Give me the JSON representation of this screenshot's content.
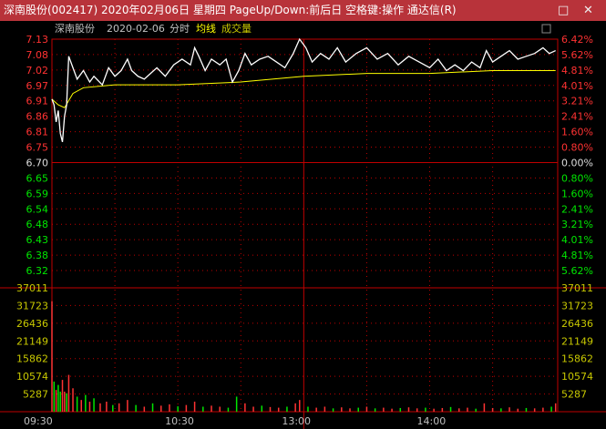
{
  "window": {
    "title": "深南股份(002417) 2020年02月06日 星期四 PageUp/Down:前后日 空格键:操作 通达信(R)",
    "restore": "□",
    "close": "✕"
  },
  "header": {
    "stock": "深南股份",
    "date": "2020-02-06",
    "mode": "分时",
    "avg_label": "均线",
    "vol_label": "成交量"
  },
  "colors": {
    "up": "#ff3232",
    "down": "#00e600",
    "price_line": "#ffffff",
    "avg_line": "#ffff00",
    "grid": "#c00000",
    "title_bg": "#b8333a"
  },
  "chart_data": {
    "type": "line",
    "prev_close": 6.7,
    "ylim": [
      6.32,
      7.13
    ],
    "price_ticks": [
      "7.13",
      "7.08",
      "7.02",
      "6.97",
      "6.91",
      "6.86",
      "6.81",
      "6.75",
      "6.70",
      "6.65",
      "6.59",
      "6.54",
      "6.48",
      "6.43",
      "6.38",
      "6.32"
    ],
    "pct_ticks": [
      "6.42%",
      "5.62%",
      "4.81%",
      "4.01%",
      "3.21%",
      "2.41%",
      "1.60%",
      "0.80%",
      "0.00%",
      "0.80%",
      "1.60%",
      "2.41%",
      "3.21%",
      "4.01%",
      "4.81%",
      "5.62%"
    ],
    "vol_ticks": [
      "37011",
      "31723",
      "26436",
      "21149",
      "15862",
      "10574",
      "5287"
    ],
    "vol_ylim": [
      0,
      37011
    ],
    "x_ticks": [
      "09:30",
      "10:30",
      "13:00",
      "14:00"
    ],
    "price": [
      [
        0,
        6.92
      ],
      [
        1,
        6.9
      ],
      [
        2,
        6.84
      ],
      [
        3,
        6.88
      ],
      [
        4,
        6.8
      ],
      [
        5,
        6.77
      ],
      [
        6,
        6.86
      ],
      [
        7,
        6.9
      ],
      [
        8,
        7.07
      ],
      [
        10,
        7.03
      ],
      [
        12,
        6.99
      ],
      [
        15,
        7.02
      ],
      [
        18,
        6.98
      ],
      [
        20,
        7.0
      ],
      [
        24,
        6.97
      ],
      [
        27,
        7.03
      ],
      [
        30,
        7.0
      ],
      [
        33,
        7.02
      ],
      [
        36,
        7.06
      ],
      [
        38,
        7.02
      ],
      [
        41,
        7.0
      ],
      [
        44,
        6.99
      ],
      [
        47,
        7.01
      ],
      [
        50,
        7.03
      ],
      [
        54,
        7.0
      ],
      [
        58,
        7.04
      ],
      [
        62,
        7.06
      ],
      [
        66,
        7.04
      ],
      [
        68,
        7.1
      ],
      [
        70,
        7.07
      ],
      [
        73,
        7.02
      ],
      [
        76,
        7.06
      ],
      [
        80,
        7.04
      ],
      [
        83,
        7.06
      ],
      [
        86,
        6.98
      ],
      [
        89,
        7.02
      ],
      [
        92,
        7.08
      ],
      [
        95,
        7.04
      ],
      [
        99,
        7.06
      ],
      [
        103,
        7.07
      ],
      [
        107,
        7.05
      ],
      [
        111,
        7.03
      ],
      [
        115,
        7.08
      ],
      [
        118,
        7.13
      ],
      [
        121,
        7.1
      ],
      [
        124,
        7.05
      ],
      [
        128,
        7.08
      ],
      [
        132,
        7.06
      ],
      [
        136,
        7.1
      ],
      [
        140,
        7.05
      ],
      [
        145,
        7.08
      ],
      [
        150,
        7.1
      ],
      [
        155,
        7.06
      ],
      [
        160,
        7.08
      ],
      [
        165,
        7.04
      ],
      [
        170,
        7.07
      ],
      [
        175,
        7.05
      ],
      [
        180,
        7.03
      ],
      [
        184,
        7.06
      ],
      [
        188,
        7.02
      ],
      [
        192,
        7.04
      ],
      [
        196,
        7.02
      ],
      [
        200,
        7.05
      ],
      [
        204,
        7.03
      ],
      [
        207,
        7.09
      ],
      [
        210,
        7.05
      ],
      [
        214,
        7.07
      ],
      [
        218,
        7.09
      ],
      [
        222,
        7.06
      ],
      [
        226,
        7.07
      ],
      [
        230,
        7.08
      ],
      [
        234,
        7.1
      ],
      [
        237,
        7.08
      ],
      [
        240,
        7.09
      ]
    ],
    "avg": [
      [
        0,
        6.92
      ],
      [
        3,
        6.9
      ],
      [
        6,
        6.89
      ],
      [
        10,
        6.94
      ],
      [
        15,
        6.96
      ],
      [
        30,
        6.97
      ],
      [
        60,
        6.97
      ],
      [
        90,
        6.98
      ],
      [
        120,
        7.0
      ],
      [
        150,
        7.01
      ],
      [
        180,
        7.01
      ],
      [
        210,
        7.02
      ],
      [
        240,
        7.02
      ]
    ],
    "volume": [
      [
        0,
        33000,
        "u"
      ],
      [
        1,
        9000,
        "d"
      ],
      [
        2,
        6500,
        "u"
      ],
      [
        3,
        8000,
        "d"
      ],
      [
        4,
        6000,
        "d"
      ],
      [
        5,
        9500,
        "u"
      ],
      [
        6,
        6000,
        "u"
      ],
      [
        7,
        5500,
        "d"
      ],
      [
        8,
        11000,
        "u"
      ],
      [
        10,
        7000,
        "u"
      ],
      [
        12,
        4500,
        "d"
      ],
      [
        14,
        3500,
        "u"
      ],
      [
        16,
        5000,
        "d"
      ],
      [
        18,
        3000,
        "u"
      ],
      [
        20,
        4000,
        "d"
      ],
      [
        23,
        2500,
        "u"
      ],
      [
        26,
        3000,
        "u"
      ],
      [
        29,
        2000,
        "d"
      ],
      [
        32,
        2500,
        "u"
      ],
      [
        36,
        3500,
        "u"
      ],
      [
        40,
        2000,
        "d"
      ],
      [
        44,
        1500,
        "u"
      ],
      [
        48,
        2500,
        "d"
      ],
      [
        52,
        1800,
        "u"
      ],
      [
        56,
        2200,
        "u"
      ],
      [
        60,
        1600,
        "d"
      ],
      [
        64,
        2000,
        "u"
      ],
      [
        68,
        3000,
        "u"
      ],
      [
        72,
        1500,
        "d"
      ],
      [
        76,
        1800,
        "u"
      ],
      [
        80,
        1500,
        "u"
      ],
      [
        84,
        1200,
        "d"
      ],
      [
        88,
        4500,
        "d"
      ],
      [
        92,
        2500,
        "u"
      ],
      [
        96,
        1500,
        "u"
      ],
      [
        100,
        1800,
        "d"
      ],
      [
        104,
        1400,
        "u"
      ],
      [
        108,
        1200,
        "u"
      ],
      [
        112,
        1500,
        "d"
      ],
      [
        116,
        2500,
        "u"
      ],
      [
        118,
        3500,
        "u"
      ],
      [
        122,
        1500,
        "d"
      ],
      [
        126,
        1200,
        "u"
      ],
      [
        130,
        1500,
        "u"
      ],
      [
        134,
        1000,
        "d"
      ],
      [
        138,
        1300,
        "u"
      ],
      [
        142,
        1000,
        "u"
      ],
      [
        146,
        1200,
        "d"
      ],
      [
        150,
        1500,
        "u"
      ],
      [
        154,
        1000,
        "d"
      ],
      [
        158,
        1200,
        "u"
      ],
      [
        162,
        900,
        "u"
      ],
      [
        166,
        1100,
        "d"
      ],
      [
        170,
        1300,
        "u"
      ],
      [
        174,
        1000,
        "u"
      ],
      [
        178,
        1200,
        "d"
      ],
      [
        182,
        900,
        "u"
      ],
      [
        186,
        1100,
        "u"
      ],
      [
        190,
        1400,
        "d"
      ],
      [
        194,
        1000,
        "u"
      ],
      [
        198,
        1200,
        "u"
      ],
      [
        202,
        900,
        "d"
      ],
      [
        206,
        2500,
        "u"
      ],
      [
        210,
        1100,
        "u"
      ],
      [
        214,
        1000,
        "d"
      ],
      [
        218,
        1300,
        "u"
      ],
      [
        222,
        900,
        "u"
      ],
      [
        226,
        1100,
        "d"
      ],
      [
        230,
        1000,
        "u"
      ],
      [
        234,
        1200,
        "u"
      ],
      [
        238,
        1500,
        "d"
      ],
      [
        240,
        2500,
        "u"
      ]
    ]
  }
}
